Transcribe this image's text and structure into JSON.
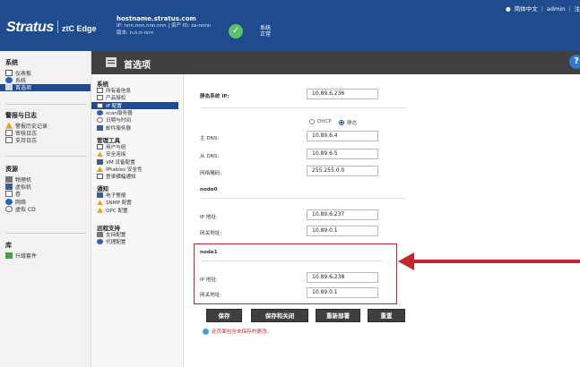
{
  "topbar": {
    "brand": "Stratus",
    "edition": "ztC Edge",
    "hostname": "hostname.stratus.com",
    "ip_line": "IP: nnn.nnn.nnn.nnn | 资产 ID: zа-nnnn",
    "version_line": "版本: n.n.n-nnn",
    "status_line1": "系统",
    "status_line2": "正常",
    "language": "简体中文",
    "user": "admin",
    "extra": "注"
  },
  "leftnav": {
    "sections": [
      {
        "title": "系统",
        "items": [
          {
            "label": "仪表板",
            "icon": "dashboard-icon"
          },
          {
            "label": "系统",
            "icon": "system-icon"
          },
          {
            "label": "首选项",
            "icon": "preferences-icon",
            "active": true
          }
        ]
      },
      {
        "title": "警报与日志",
        "items": [
          {
            "label": "警报历史记录",
            "icon": "alert-icon"
          },
          {
            "label": "审核日志",
            "icon": "audit-log-icon"
          },
          {
            "label": "支持日志",
            "icon": "support-log-icon"
          }
        ]
      },
      {
        "title": "资源",
        "items": [
          {
            "label": "物理机",
            "icon": "physical-machine-icon"
          },
          {
            "label": "虚拟机",
            "icon": "virtual-machine-icon"
          },
          {
            "label": "卷",
            "icon": "volume-icon"
          },
          {
            "label": "网络",
            "icon": "network-icon"
          },
          {
            "label": "虚拟 CD",
            "icon": "virtual-cd-icon"
          }
        ]
      },
      {
        "title": "库",
        "items": [
          {
            "label": "升级套件",
            "icon": "upgrade-kit-icon"
          }
        ]
      }
    ]
  },
  "header": {
    "title": "首选项"
  },
  "subnav": {
    "sections": [
      {
        "title": "系统",
        "items": [
          {
            "label": "所有者信息"
          },
          {
            "label": "产品授权"
          },
          {
            "label": "IP 配置",
            "active": true
          },
          {
            "label": "scan服务器"
          },
          {
            "label": "日期与时间"
          },
          {
            "label": "邮件服务器"
          }
        ]
      },
      {
        "title": "管理工具",
        "items": [
          {
            "label": "用户与组"
          },
          {
            "label": "安全连接"
          },
          {
            "label": "VM 设备配置"
          },
          {
            "label": "IPtables 安全性"
          },
          {
            "label": "登录横幅通知"
          }
        ]
      },
      {
        "title": "通知",
        "items": [
          {
            "label": "电子警报"
          },
          {
            "label": "SNMP 配置"
          },
          {
            "label": "OPC 配置"
          }
        ]
      },
      {
        "title": "远程支持",
        "items": [
          {
            "label": "支持配置"
          },
          {
            "label": "代理配置"
          }
        ]
      }
    ]
  },
  "form": {
    "static_ip_label": "静态系统 IP:",
    "static_ip_value": "10.89.6.236",
    "radio_dhcp": "DHCP",
    "radio_static": "静态",
    "primary_dns_label": "主 DNS:",
    "primary_dns_value": "10.89.6.4",
    "secondary_dns_label": "从 DNS:",
    "secondary_dns_value": "10.89.6.5",
    "netmask_label": "网络掩码:",
    "netmask_value": "255.255.0.0",
    "node0_title": "node0",
    "node0_ip_label": "IP 地址:",
    "node0_ip_value": "10.89.6.237",
    "node0_gw_label": "网关地址:",
    "node0_gw_value": "10.89.0.1",
    "node1_title": "node1",
    "node1_ip_label": "IP 地址:",
    "node1_ip_value": "10.89.6.238",
    "node1_gw_label": "网关地址:",
    "node1_gw_value": "10.89.0.1"
  },
  "buttons": {
    "save": "保存",
    "save_close": "保存和关闭",
    "reboot": "重新部署",
    "reset": "重置"
  },
  "warning": "此页面包含未保存的更改。",
  "colors": {
    "topbar": "#1f4c8f",
    "header": "#404040",
    "highlight": "#c4262e",
    "status_ok": "#5cc36b"
  }
}
